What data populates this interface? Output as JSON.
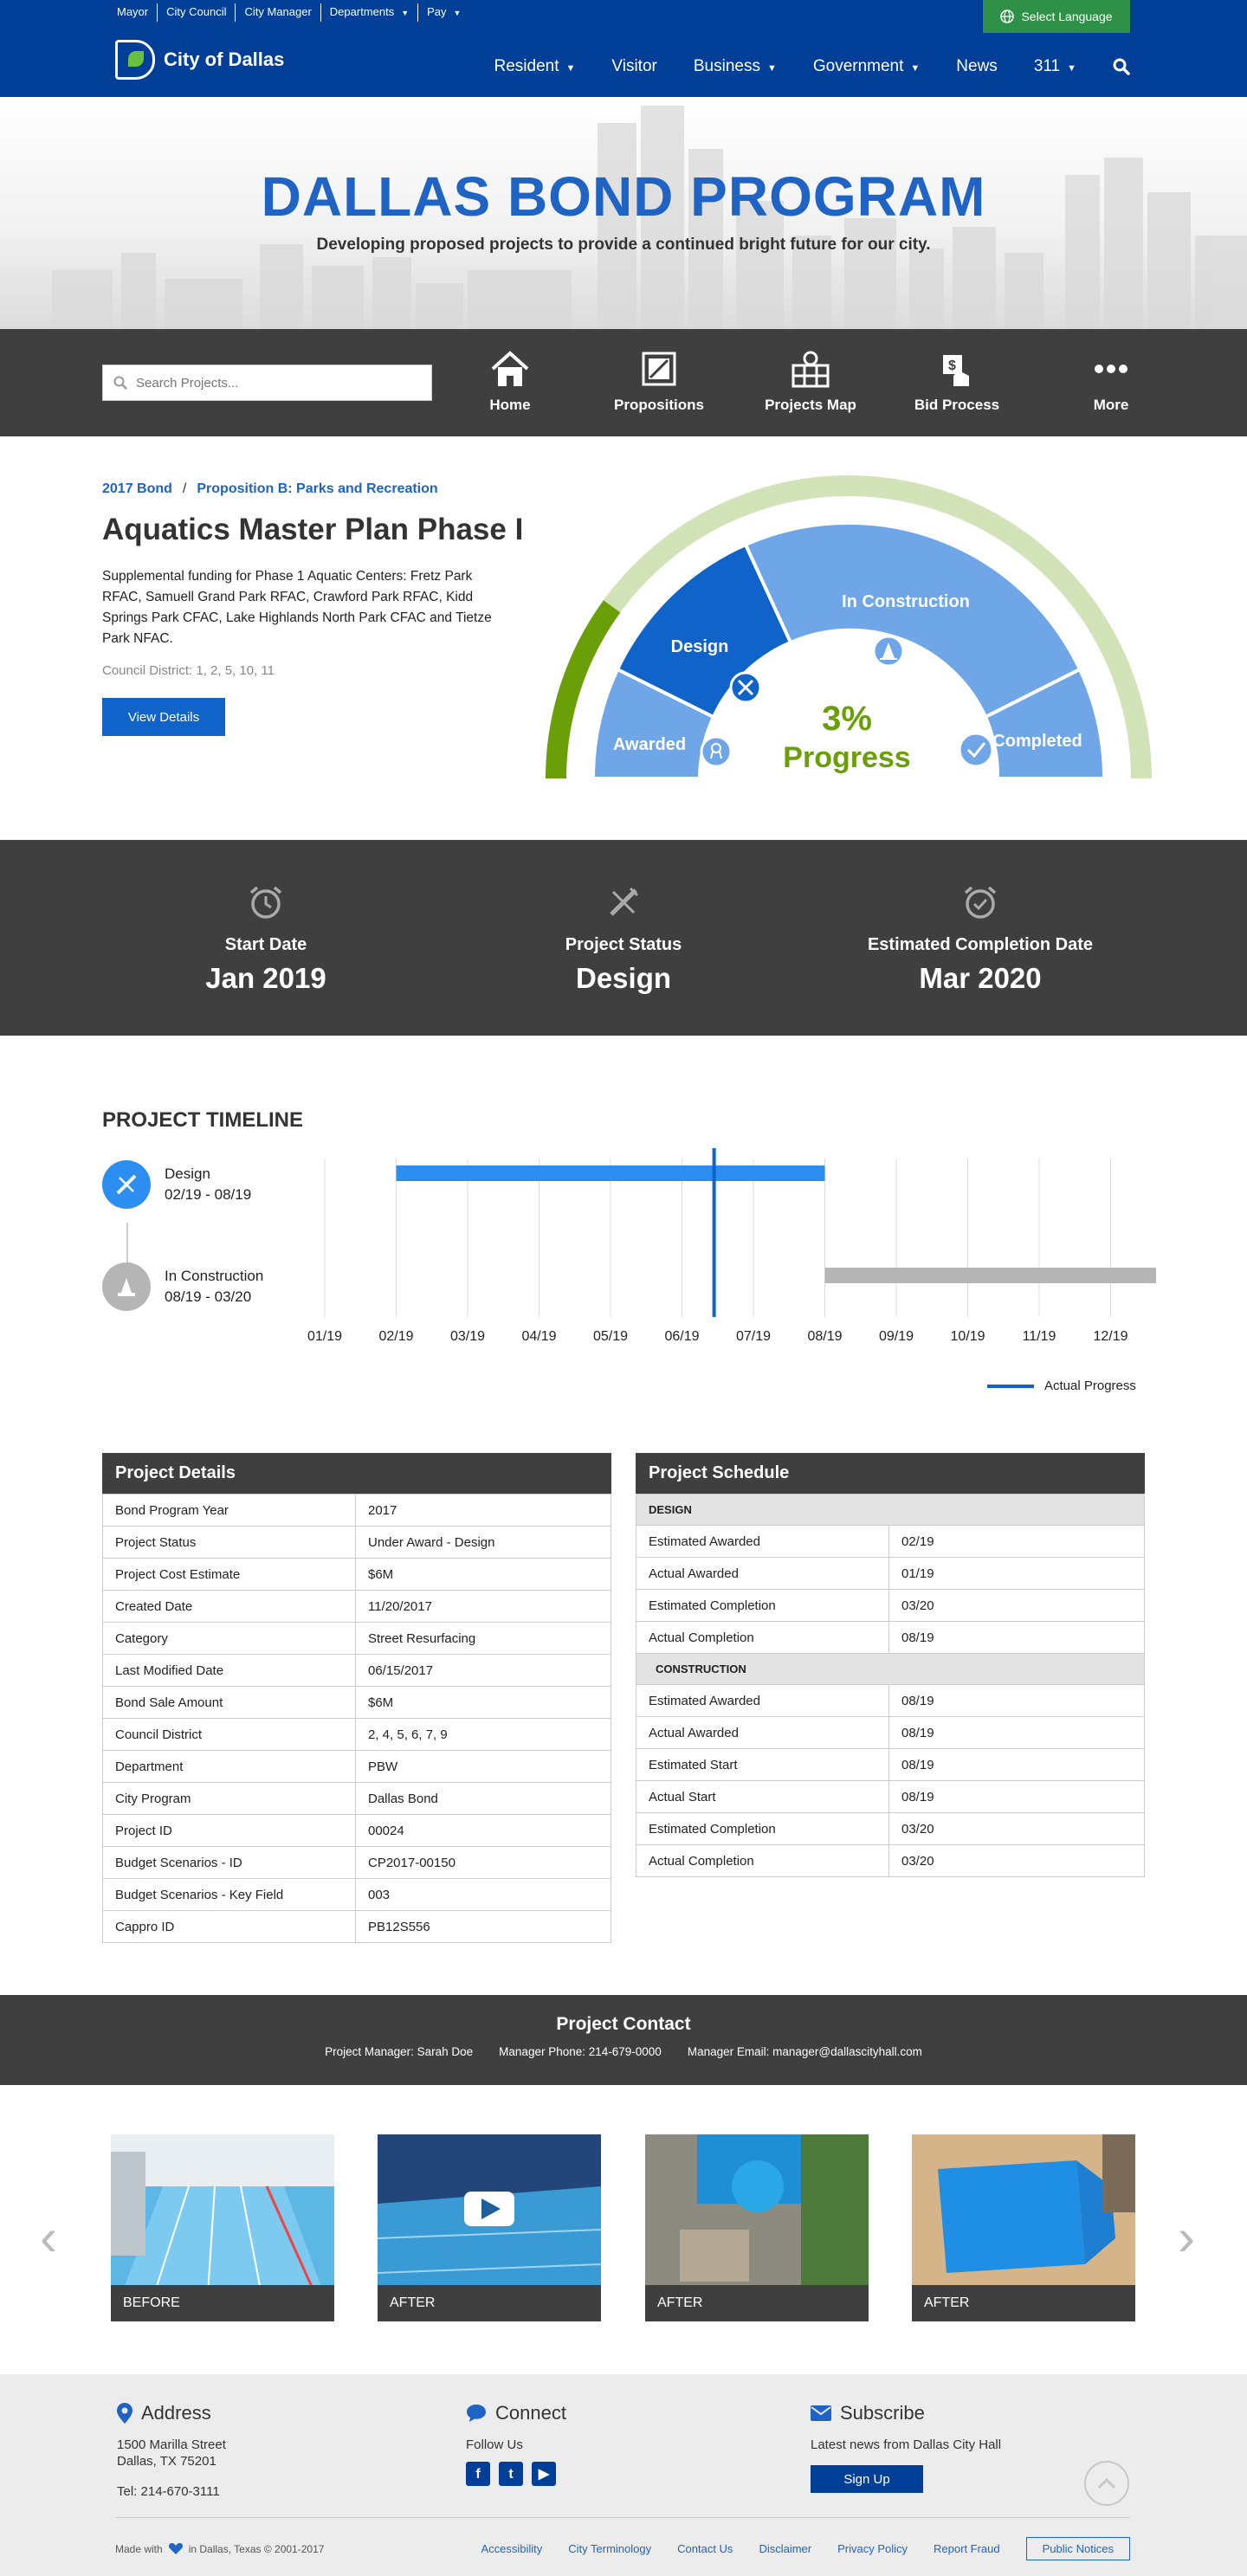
{
  "header": {
    "util_links": [
      "Mayor",
      "City Council",
      "City Manager",
      "Departments",
      "Pay"
    ],
    "language_button": "Select Language",
    "logo_text": "City of Dallas",
    "nav": [
      {
        "label": "Resident",
        "has_caret": true
      },
      {
        "label": "Visitor",
        "has_caret": false
      },
      {
        "label": "Business",
        "has_caret": true
      },
      {
        "label": "Government",
        "has_caret": true
      },
      {
        "label": "News",
        "has_caret": false
      },
      {
        "label": "311",
        "has_caret": true
      }
    ]
  },
  "hero": {
    "title": "DALLAS BOND PROGRAM",
    "subtitle": "Developing proposed projects to provide a continued bright future for our city."
  },
  "toolbar": {
    "search_placeholder": "Search Projects...",
    "items": [
      "Home",
      "Propositions",
      "Projects Map",
      "Bid Process",
      "More"
    ]
  },
  "project": {
    "breadcrumb": [
      "2017 Bond",
      "Proposition B: Parks and Recreation"
    ],
    "title": "Aquatics Master Plan Phase I",
    "description": "Supplemental funding for Phase 1 Aquatic Centers: Fretz Park RFAC, Samuell Grand Park RFAC, Crawford Park RFAC, Kidd Springs Park CFAC, Lake Highlands North Park CFAC and Tietze Park NFAC.",
    "district": "Council District: 1, 2, 5, 10, 11",
    "details_button": "View Details"
  },
  "gauge": {
    "percent_label": "3%",
    "progress_label": "Progress",
    "progress_fraction": 0.03,
    "segments": [
      "Awarded",
      "Design",
      "In Construction",
      "Completed"
    ],
    "colors": {
      "active": "#0f63c9",
      "inactive": "#6ea6e8",
      "outer_track": "#d2e3b8",
      "outer_fill": "#6a9f08",
      "progress_text": "#6a9f08"
    }
  },
  "status": {
    "items": [
      {
        "label": "Start Date",
        "value": "Jan 2019",
        "icon": "alarm-clock-icon"
      },
      {
        "label": "Project Status",
        "value": "Design",
        "icon": "design-tools-icon"
      },
      {
        "label": "Estimated Completion Date",
        "value": "Mar 2020",
        "icon": "check-clock-icon"
      }
    ]
  },
  "timeline": {
    "heading": "PROJECT TIMELINE",
    "phases": [
      {
        "name": "Design",
        "range": "02/19 - 08/19",
        "icon": "design-tools-icon",
        "color": "#2c8ef0"
      },
      {
        "name": "In Construction",
        "range": "08/19 - 03/20",
        "icon": "traffic-cone-icon",
        "color": "#b5b5b5"
      }
    ],
    "legend": "Actual Progress"
  },
  "chart_data": {
    "type": "bar",
    "categories": [
      "01/19",
      "02/19",
      "03/19",
      "04/19",
      "05/19",
      "06/19",
      "07/19",
      "08/19",
      "09/19",
      "10/19",
      "11/19",
      "12/19"
    ],
    "series": [
      {
        "name": "Design",
        "start": "02/19",
        "end": "08/19",
        "color": "#2c8ef0"
      },
      {
        "name": "In Construction",
        "start": "08/19",
        "end": "03/20",
        "color": "#b5b5b5"
      }
    ],
    "actual_progress": "06/19",
    "actual_progress_month_fraction": 0.45,
    "legend": [
      "Actual Progress"
    ],
    "grid": true
  },
  "details": {
    "heading": "Project Details",
    "rows": [
      [
        "Bond Program Year",
        "2017"
      ],
      [
        "Project Status",
        "Under Award - Design"
      ],
      [
        "Project Cost Estimate",
        "$6M"
      ],
      [
        "Created Date",
        "11/20/2017"
      ],
      [
        "Category",
        "Street Resurfacing"
      ],
      [
        "Last Modified Date",
        "06/15/2017"
      ],
      [
        "Bond Sale Amount",
        "$6M"
      ],
      [
        "Council District",
        "2, 4, 5, 6, 7, 9"
      ],
      [
        "Department",
        "PBW"
      ],
      [
        "City Program",
        "Dallas Bond"
      ],
      [
        "Project ID",
        "00024"
      ],
      [
        "Budget Scenarios - ID",
        "CP2017-00150"
      ],
      [
        "Budget Scenarios - Key Field",
        "003"
      ],
      [
        "Cappro ID",
        "PB12S556"
      ]
    ]
  },
  "schedule": {
    "heading": "Project Schedule",
    "sections": [
      {
        "title": "DESIGN",
        "rows": [
          [
            "Estimated Awarded",
            "02/19"
          ],
          [
            "Actual Awarded",
            "01/19"
          ],
          [
            "Estimated Completion",
            "03/20"
          ],
          [
            "Actual Completion",
            "08/19"
          ]
        ]
      },
      {
        "title": "CONSTRUCTION",
        "rows": [
          [
            "Estimated Awarded",
            "08/19"
          ],
          [
            "Actual Awarded",
            "08/19"
          ],
          [
            "Estimated Start",
            "08/19"
          ],
          [
            "Actual Start",
            "08/19"
          ],
          [
            "Estimated Completion",
            "03/20"
          ],
          [
            "Actual Completion",
            "03/20"
          ]
        ]
      }
    ]
  },
  "contact": {
    "title": "Project Contact",
    "manager": "Project Manager: Sarah Doe",
    "phone": "Manager Phone: 214-679-0000",
    "email": "Manager Email: manager@dallascityhall.com"
  },
  "gallery": {
    "photos": [
      "BEFORE",
      "AFTER",
      "AFTER",
      "AFTER"
    ]
  },
  "footer": {
    "address_heading": "Address",
    "address_line1": "1500 Marilla Street",
    "address_line2": "Dallas, TX 75201",
    "tel": "Tel: 214-670-3111",
    "connect_heading": "Connect",
    "follow": "Follow Us",
    "subscribe_heading": "Subscribe",
    "subscribe_text": "Latest news from Dallas City Hall",
    "signup": "Sign Up",
    "made_with_prefix": "Made with",
    "made_with_suffix": "in Dallas, Texas © 2001-2017",
    "links": [
      "Accessibility",
      "City Terminology",
      "Contact Us",
      "Disclaimer",
      "Privacy Policy",
      "Report Fraud"
    ],
    "public_notices": "Public Notices"
  }
}
